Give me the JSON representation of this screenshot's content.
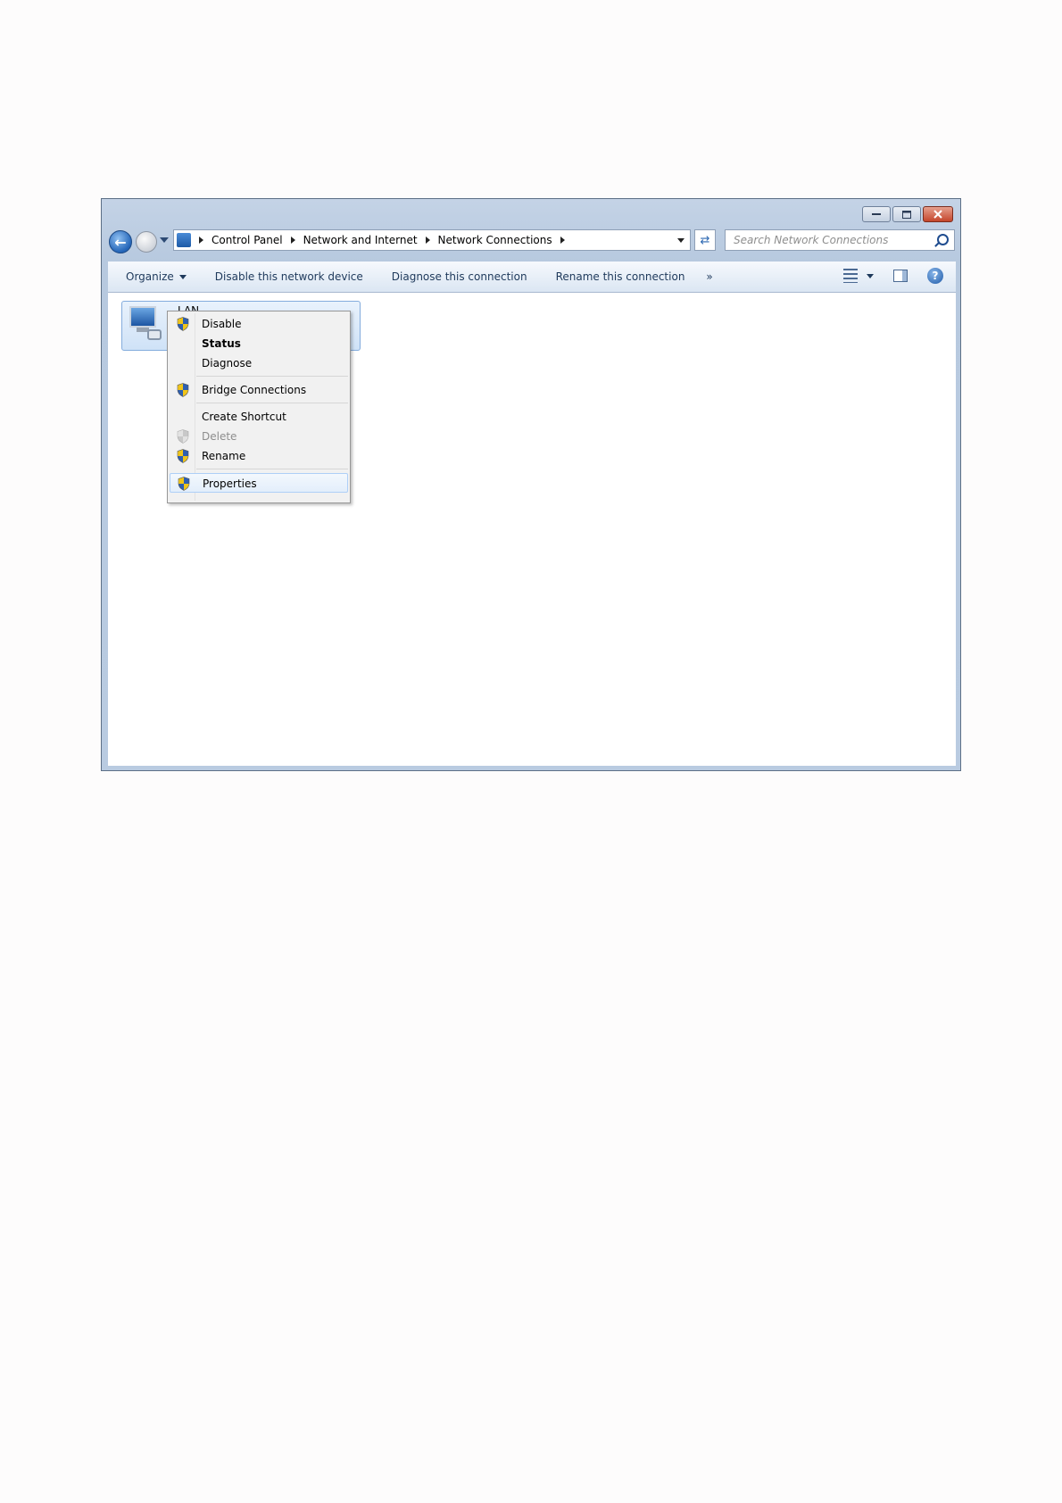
{
  "window": {
    "address": {
      "crumbs": [
        "Control Panel",
        "Network and Internet",
        "Network Connections"
      ]
    },
    "search": {
      "placeholder": "Search Network Connections"
    }
  },
  "toolbar": {
    "organize": "Organize",
    "disable": "Disable this network device",
    "diagnose": "Diagnose this connection",
    "rename": "Rename this connection",
    "more": "»"
  },
  "connection": {
    "name": "LAN"
  },
  "context_menu": {
    "items": [
      {
        "label": "Disable"
      },
      {
        "label": "Status"
      },
      {
        "label": "Diagnose"
      },
      {
        "label": "Bridge Connections"
      },
      {
        "label": "Create Shortcut"
      },
      {
        "label": "Delete"
      },
      {
        "label": "Rename"
      },
      {
        "label": "Properties"
      }
    ]
  },
  "colors": {
    "accent": "#2465b8",
    "close": "#c4462c",
    "shield_blue": "#2e5fb0",
    "shield_yellow": "#f0c419"
  },
  "icons": [
    "back-icon",
    "forward-icon",
    "recent-pages-icon",
    "control-panel-icon",
    "refresh-icon",
    "search-icon",
    "views-icon",
    "preview-pane-icon",
    "help-icon",
    "network-adapter-icon",
    "uac-shield-icon"
  ]
}
